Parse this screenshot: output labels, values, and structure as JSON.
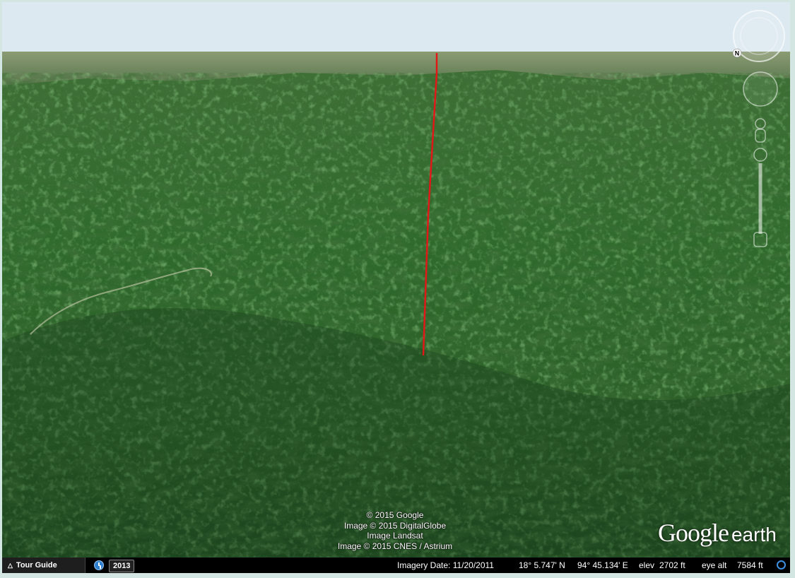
{
  "credits": {
    "line1": "© 2015 Google",
    "line2": "Image © 2015 DigitalGlobe",
    "line3": "Image Landsat",
    "line4": "Image © 2015 CNES / Astrium"
  },
  "logo": {
    "google": "Google",
    "earth": "earth"
  },
  "compass": {
    "north_label": "N"
  },
  "statusbar": {
    "tour_guide": "Tour Guide",
    "historical_year": "2013",
    "imagery_date": "Imagery Date: 11/20/2011",
    "lat": "18° 5.747' N",
    "lon": "94° 45.134' E",
    "elev_label": "elev",
    "elev_value": "2702 ft",
    "eye_alt_label": "eye alt",
    "eye_alt_value": "7584 ft"
  },
  "icons": {
    "tour": "tour-guide-caret-icon",
    "history": "historical-imagery-icon",
    "streaming": "streaming-status-icon",
    "look": "look-joystick-icon",
    "move": "move-joystick-icon",
    "street": "street-view-pegman-icon",
    "zoom": "zoom-slider-icon"
  },
  "colors": {
    "path_line": "#e01818",
    "sky": "#dfeaf2",
    "terrain": "#2f5a2a",
    "statusbar": "#000000"
  }
}
